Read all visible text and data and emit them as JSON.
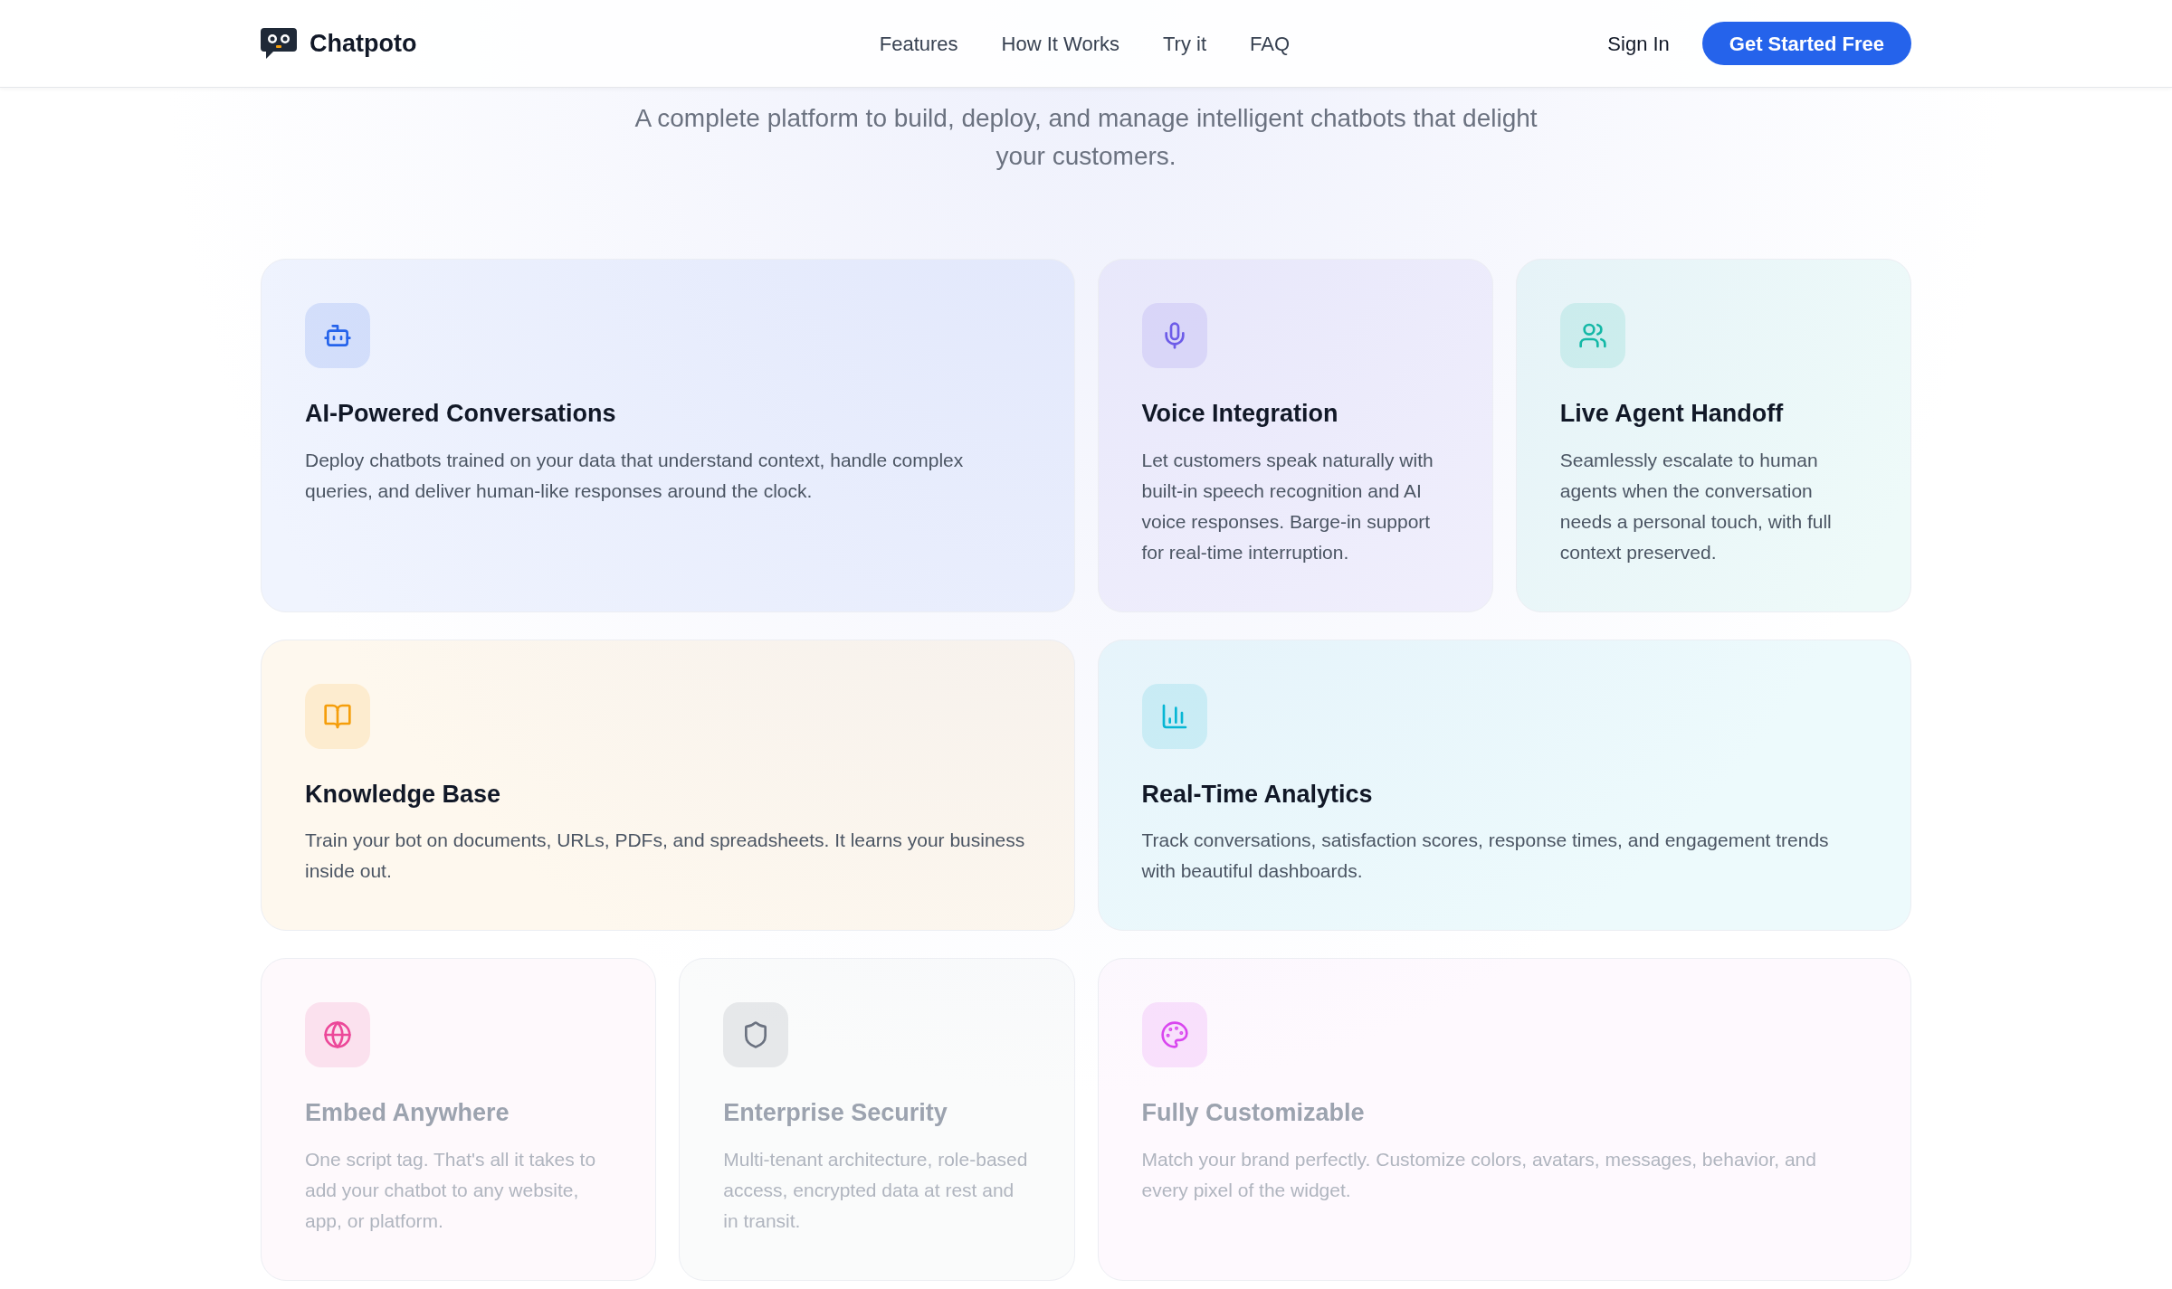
{
  "header": {
    "brand": "Chatpoto",
    "nav": [
      {
        "label": "Features"
      },
      {
        "label": "How It Works"
      },
      {
        "label": "Try it"
      },
      {
        "label": "FAQ"
      }
    ],
    "sign_in": "Sign In",
    "cta": "Get Started Free"
  },
  "hero": {
    "subtitle": "A complete platform to build, deploy, and manage intelligent chatbots that delight your customers."
  },
  "features": [
    {
      "kind": "bot",
      "color": "#2563eb",
      "title": "AI-Powered Conversations",
      "text": "Deploy chatbots trained on your data that understand context, handle complex queries, and deliver human-like responses around the clock.",
      "dimmed": false
    },
    {
      "kind": "mic",
      "color": "#6d5ce8",
      "title": "Voice Integration",
      "text": "Let customers speak naturally with built-in speech recognition and AI voice responses. Barge-in support for real-time interruption.",
      "dimmed": false
    },
    {
      "kind": "users",
      "color": "#14b8a6",
      "title": "Live Agent Handoff",
      "text": "Seamlessly escalate to human agents when the conversation needs a personal touch, with full context preserved.",
      "dimmed": false
    },
    {
      "kind": "book",
      "color": "#f59e0b",
      "title": "Knowledge Base",
      "text": "Train your bot on documents, URLs, PDFs, and spreadsheets. It learns your business inside out.",
      "dimmed": false
    },
    {
      "kind": "chart",
      "color": "#06b6d4",
      "title": "Real-Time Analytics",
      "text": "Track conversations, satisfaction scores, response times, and engagement trends with beautiful dashboards.",
      "dimmed": false
    },
    {
      "kind": "globe",
      "color": "#ec4899",
      "title": "Embed Anywhere",
      "text": "One script tag. That's all it takes to add your chatbot to any website, app, or platform.",
      "dimmed": true
    },
    {
      "kind": "shield",
      "color": "#6b7280",
      "title": "Enterprise Security",
      "text": "Multi-tenant architecture, role-based access, encrypted data at rest and in transit.",
      "dimmed": true
    },
    {
      "kind": "palette",
      "color": "#d946ef",
      "title": "Fully Customizable",
      "text": "Match your brand perfectly. Customize colors, avatars, messages, behavior, and every pixel of the widget.",
      "dimmed": true
    }
  ]
}
